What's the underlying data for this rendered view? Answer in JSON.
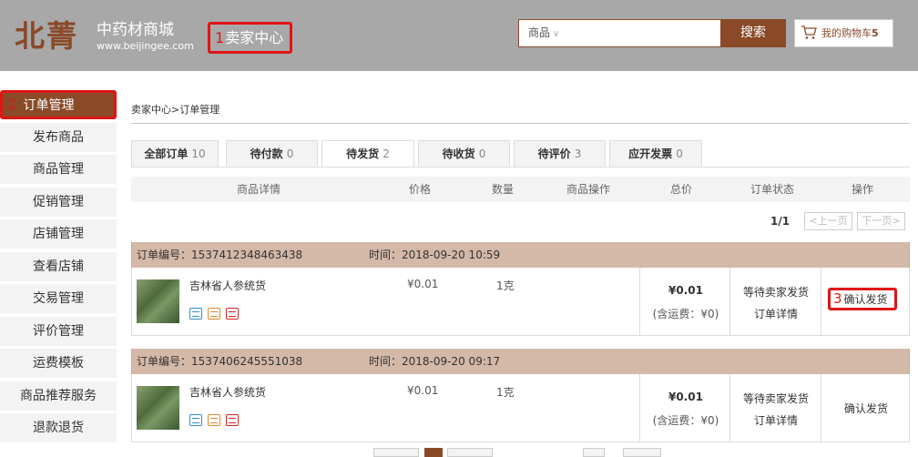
{
  "header": {
    "logo": "北菁",
    "brand_cn": "中药材商城",
    "brand_url": "www.beijingee.com",
    "seller_center": {
      "num": "1",
      "label": "卖家中心"
    },
    "search": {
      "category": "商品",
      "placeholder": "",
      "button": "搜索"
    },
    "cart": {
      "label": "我的购物车",
      "count": "5"
    }
  },
  "sidebar": {
    "items": [
      {
        "num": "2",
        "label": "订单管理"
      },
      {
        "label": "发布商品"
      },
      {
        "label": "商品管理"
      },
      {
        "label": "促销管理"
      },
      {
        "label": "店铺管理"
      },
      {
        "label": "查看店铺"
      },
      {
        "label": "交易管理"
      },
      {
        "label": "评价管理"
      },
      {
        "label": "运费模板"
      },
      {
        "label": "商品推荐服务"
      },
      {
        "label": "退款退货"
      }
    ]
  },
  "breadcrumb": "卖家中心>订单管理",
  "tabs": [
    {
      "label": "全部订单",
      "count": "10"
    },
    {
      "label": "待付款",
      "count": "0"
    },
    {
      "label": "待发货",
      "count": "2"
    },
    {
      "label": "待收货",
      "count": "0"
    },
    {
      "label": "待评价",
      "count": "3"
    },
    {
      "label": "应开发票",
      "count": "0"
    }
  ],
  "table_headers": [
    "商品详情",
    "价格",
    "数量",
    "商品操作",
    "总价",
    "订单状态",
    "操作"
  ],
  "pager": {
    "count": "1/1",
    "prev": "<上一页",
    "next": "下一页>"
  },
  "orders": [
    {
      "order_no": "订单编号：1537412348463438",
      "time": "时间：2018-09-20 10:59",
      "product": "吉林省人参统货",
      "price": "¥0.01",
      "qty": "1克",
      "total": "¥0.01",
      "shipping": "(含运费：¥0)",
      "status": "等待卖家发货",
      "detail": "订单详情",
      "op_num": "3",
      "op": "确认发货"
    },
    {
      "order_no": "订单编号：1537406245551038",
      "time": "时间：2018-09-20 09:17",
      "product": "吉林省人参统货",
      "price": "¥0.01",
      "qty": "1克",
      "total": "¥0.01",
      "shipping": "(含运费：¥0)",
      "status": "等待卖家发货",
      "detail": "订单详情",
      "op": "确认发货"
    }
  ],
  "colors": {
    "brand": "#8a4a28",
    "highlight": "#e01515",
    "order_head": "#d4b8a8"
  }
}
